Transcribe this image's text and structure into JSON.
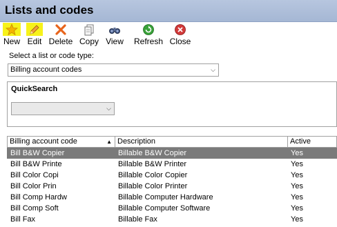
{
  "window": {
    "title": "Lists and codes"
  },
  "toolbar": {
    "new_label": "New",
    "edit_label": "Edit",
    "delete_label": "Delete",
    "copy_label": "Copy",
    "view_label": "View",
    "refresh_label": "Refresh",
    "close_label": "Close"
  },
  "selector": {
    "label": "Select a list or code type:",
    "value": "Billing account codes"
  },
  "quicksearch": {
    "title": "QuickSearch",
    "value": ""
  },
  "table": {
    "columns": [
      "Billing account code",
      "Description",
      "Active"
    ],
    "rows": [
      [
        "Bill B&W Copier",
        "Billable B&W Copier",
        "Yes"
      ],
      [
        "Bill B&W Printe",
        "Billable B&W Printer",
        "Yes"
      ],
      [
        "Bill Color Copi",
        "Billable Color Copier",
        "Yes"
      ],
      [
        "Bill Color Prin",
        "Billable Color Printer",
        "Yes"
      ],
      [
        "Bill Comp Hardw",
        "Billable Computer Hardware",
        "Yes"
      ],
      [
        "Bill Comp Soft",
        "Billable Computer Software",
        "Yes"
      ],
      [
        "Bill Fax",
        "Billable Fax",
        "Yes"
      ]
    ],
    "selected_row": 0
  },
  "colors": {
    "titlebar": "#a9bad6",
    "highlight": "#f7f21a",
    "selected_row": "#7a7a7a"
  }
}
